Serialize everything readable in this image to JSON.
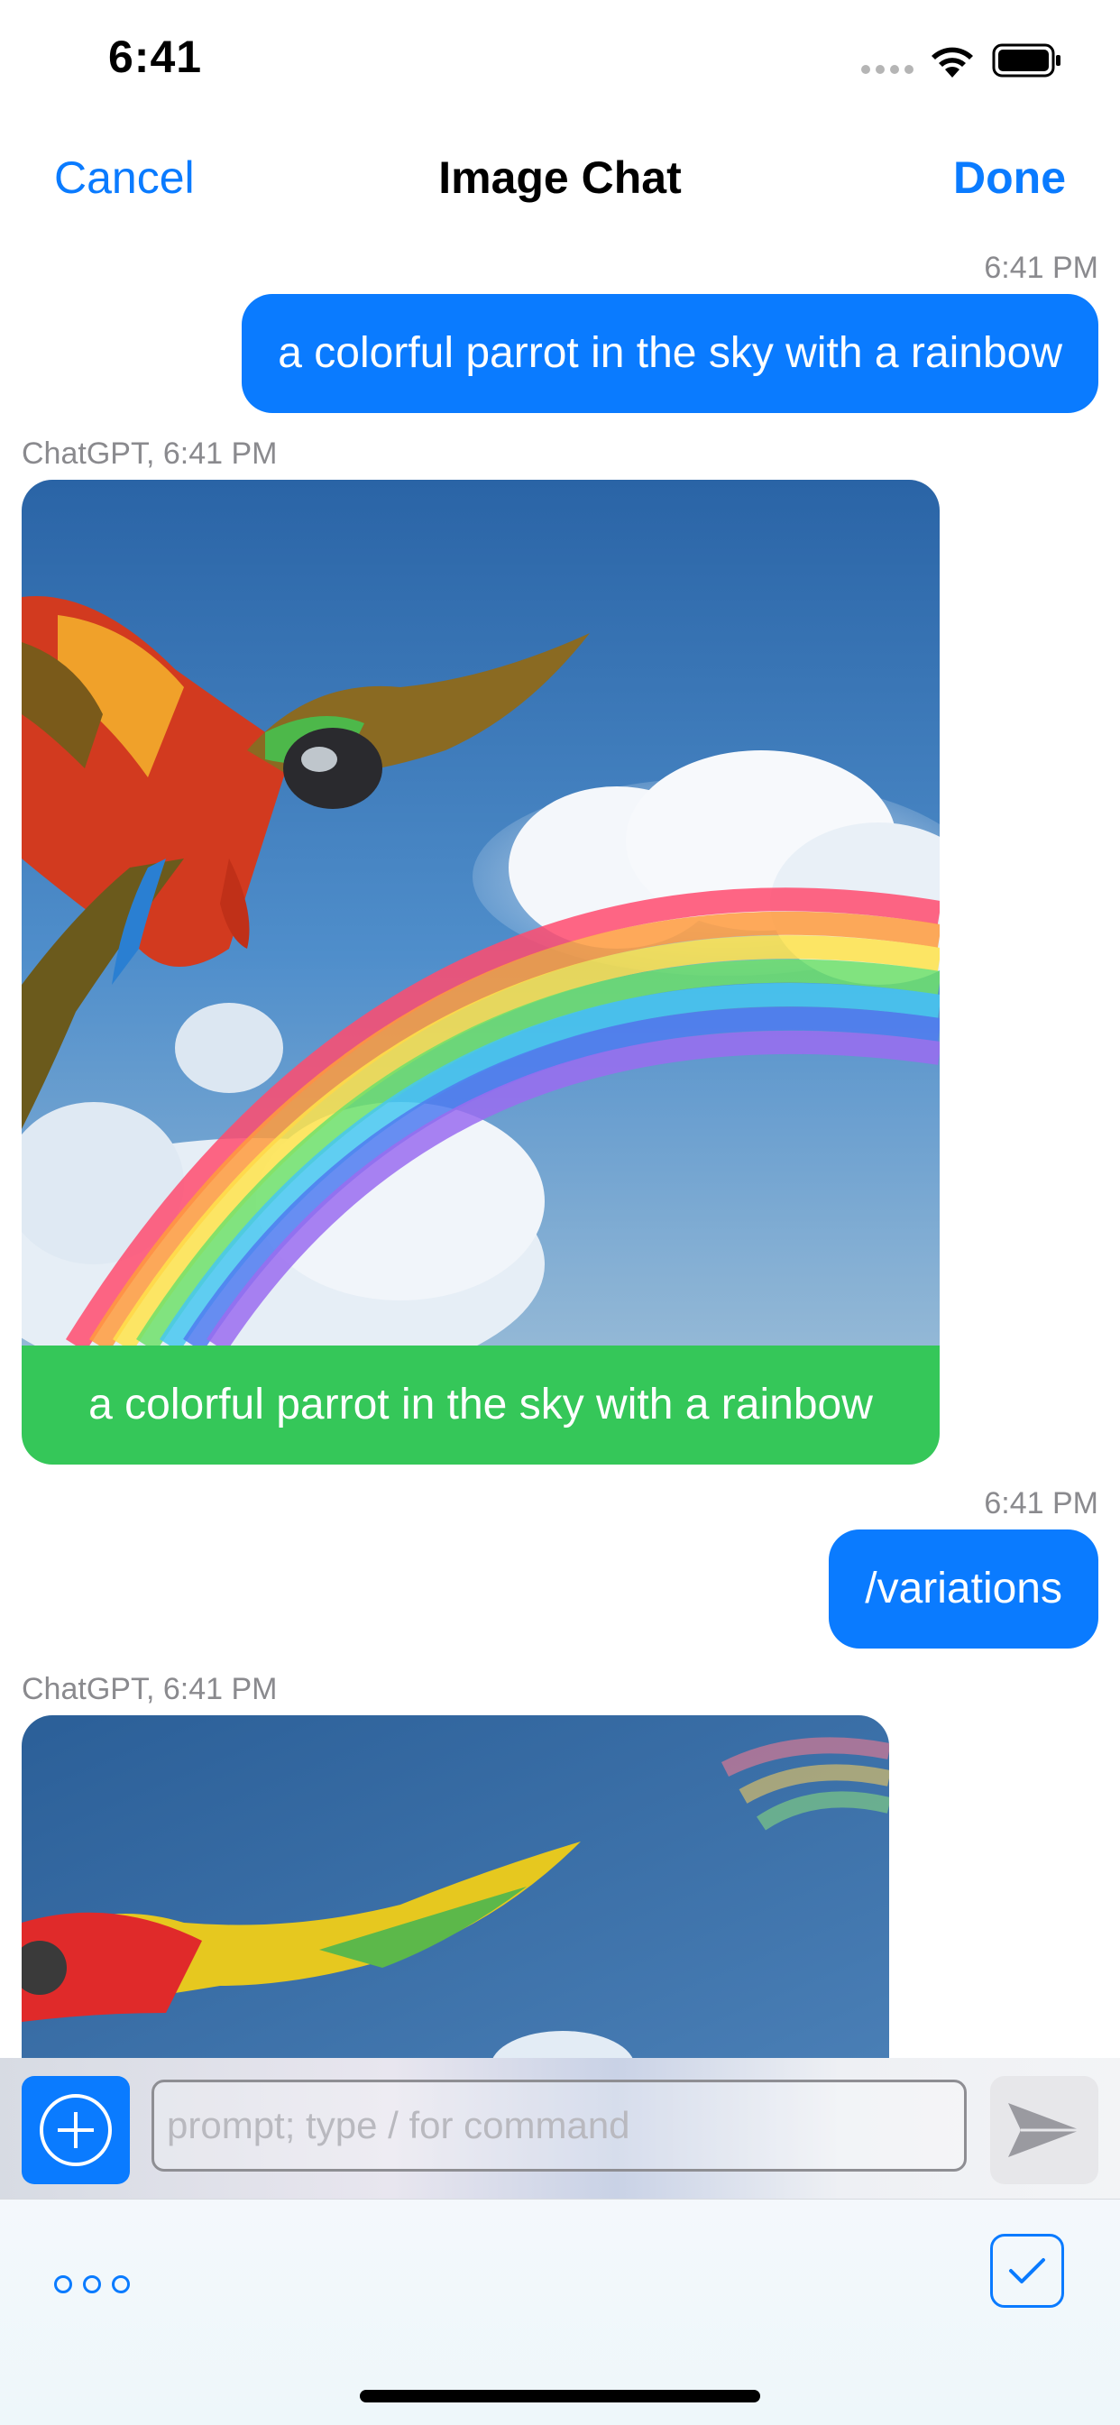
{
  "status_bar": {
    "time": "6:41"
  },
  "nav": {
    "cancel_label": "Cancel",
    "title": "Image Chat",
    "done_label": "Done"
  },
  "messages": [
    {
      "role": "user",
      "time": "6:41 PM",
      "text": "a colorful parrot in the sky with a rainbow"
    },
    {
      "role": "assistant",
      "meta": "ChatGPT, 6:41 PM",
      "caption": "a colorful parrot in the sky with a rainbow"
    },
    {
      "role": "user",
      "time": "6:41 PM",
      "text": "/variations"
    },
    {
      "role": "assistant",
      "meta": "ChatGPT, 6:41 PM"
    }
  ],
  "composer": {
    "placeholder": "prompt; type / for command"
  },
  "icons": {
    "add": "plus-circle-icon",
    "send": "paper-plane-icon",
    "more": "ellipsis-icon",
    "confirm": "checkmark-icon",
    "wifi": "wifi-icon",
    "battery": "battery-icon"
  },
  "colors": {
    "accent": "#0a7bff",
    "user_bubble": "#0a7bff",
    "caption_bubble": "#35c759",
    "timestamp": "#8a8a8e"
  }
}
